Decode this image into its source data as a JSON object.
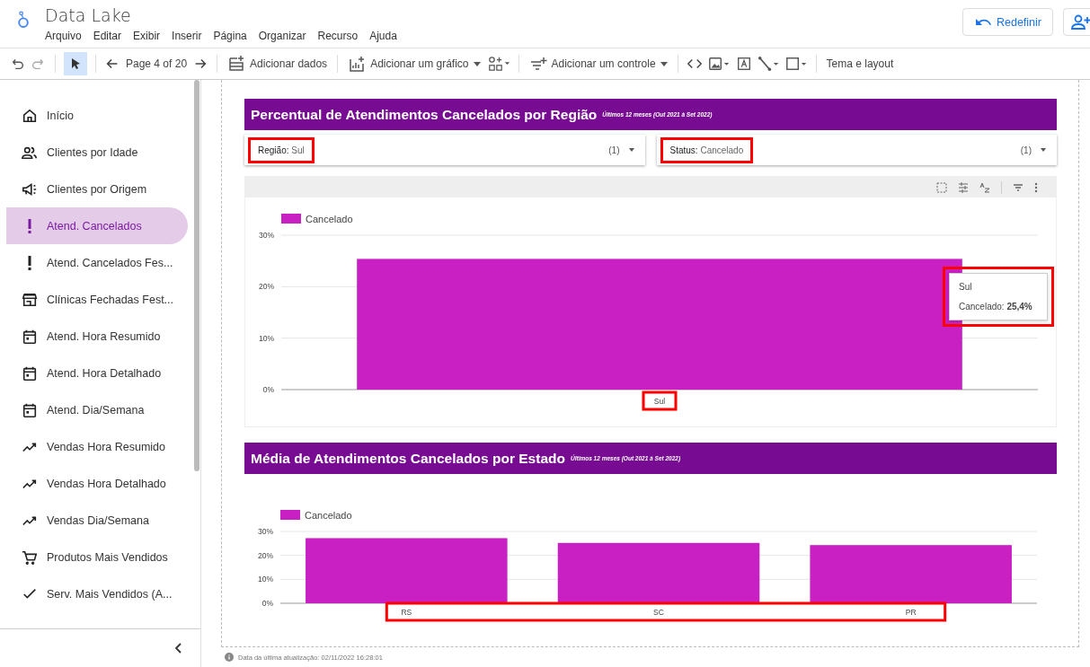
{
  "app": {
    "title": "Data Lake",
    "menu": [
      "Arquivo",
      "Editar",
      "Exibir",
      "Inserir",
      "Página",
      "Organizar",
      "Recurso",
      "Ajuda"
    ]
  },
  "header_buttons": {
    "reset": "Redefinir"
  },
  "toolbar": {
    "select_tool_selected": true,
    "page": "Page 4 of 20",
    "add_data": "Adicionar dados",
    "add_chart": "Adicionar um gráfico",
    "add_control": "Adicionar um controle",
    "theme": "Tema e layout"
  },
  "sidebar": {
    "items": [
      {
        "label": "Início",
        "selected": false
      },
      {
        "label": "Clientes por Idade",
        "selected": false
      },
      {
        "label": "Clientes por Origem",
        "selected": false
      },
      {
        "label": "Atend. Cancelados",
        "selected": true
      },
      {
        "label": "Atend. Cancelados Fes...",
        "selected": false
      },
      {
        "label": "Clínicas Fechadas Fest...",
        "selected": false
      },
      {
        "label": "Atend. Hora Resumido",
        "selected": false
      },
      {
        "label": "Atend. Hora Detalhado",
        "selected": false
      },
      {
        "label": "Atend. Dia/Semana",
        "selected": false
      },
      {
        "label": "Vendas Hora Resumido",
        "selected": false
      },
      {
        "label": "Vendas Hora Detalhado",
        "selected": false
      },
      {
        "label": "Vendas Dia/Semana",
        "selected": false
      },
      {
        "label": "Produtos Mais Vendidos",
        "selected": false
      },
      {
        "label": "Serv. Mais Vendidos (A...",
        "selected": false
      }
    ]
  },
  "sections": [
    {
      "title": "Percentual de Atendimentos Cancelados por Região",
      "subtitle": "Últimos 12 meses (Out 2021 à Set 2022)",
      "filters": [
        {
          "label": "Região:",
          "value": "Sul",
          "count": "(1)",
          "highlighted": true
        },
        {
          "label": "Status:",
          "value": "Cancelado",
          "count": "(1)",
          "highlighted": true
        }
      ],
      "chart_toolbar": true,
      "labels_highlighted": true,
      "chart_data": {
        "type": "bar",
        "categories": [
          "Sul"
        ],
        "series": [
          {
            "name": "Cancelado",
            "color": "#c820c2",
            "values": [
              25.4
            ]
          }
        ],
        "ylim": [
          0,
          30
        ],
        "yticks": [
          {
            "value": 0,
            "label": "0%"
          },
          {
            "value": 10,
            "label": "10%"
          },
          {
            "value": 20,
            "label": "20%"
          },
          {
            "value": 30,
            "label": "30%"
          }
        ]
      },
      "tooltip": {
        "title": "Sul",
        "text": "Cancelado: **25,4%**",
        "highlighted": true
      }
    },
    {
      "title": "Média de Atendimentos Cancelados por Estado",
      "subtitle": "Últimos 12 meses (Out 2021 à Set 2022)",
      "chart_toolbar": false,
      "labels_highlighted": true,
      "chart_data": {
        "type": "bar",
        "categories": [
          "RS",
          "SC",
          "PR"
        ],
        "series": [
          {
            "name": "Cancelado",
            "color": "#c820c2",
            "values": [
              27.2,
              25.2,
              24.3
            ]
          }
        ],
        "ylim": [
          0,
          30
        ],
        "yticks": [
          {
            "value": 0,
            "label": "0%"
          },
          {
            "value": 10,
            "label": "10%"
          },
          {
            "value": 20,
            "label": "20%"
          },
          {
            "value": 30,
            "label": "30%"
          }
        ]
      }
    }
  ],
  "footer": "Data da última atualização: 02/11/2022 16:28:01"
}
